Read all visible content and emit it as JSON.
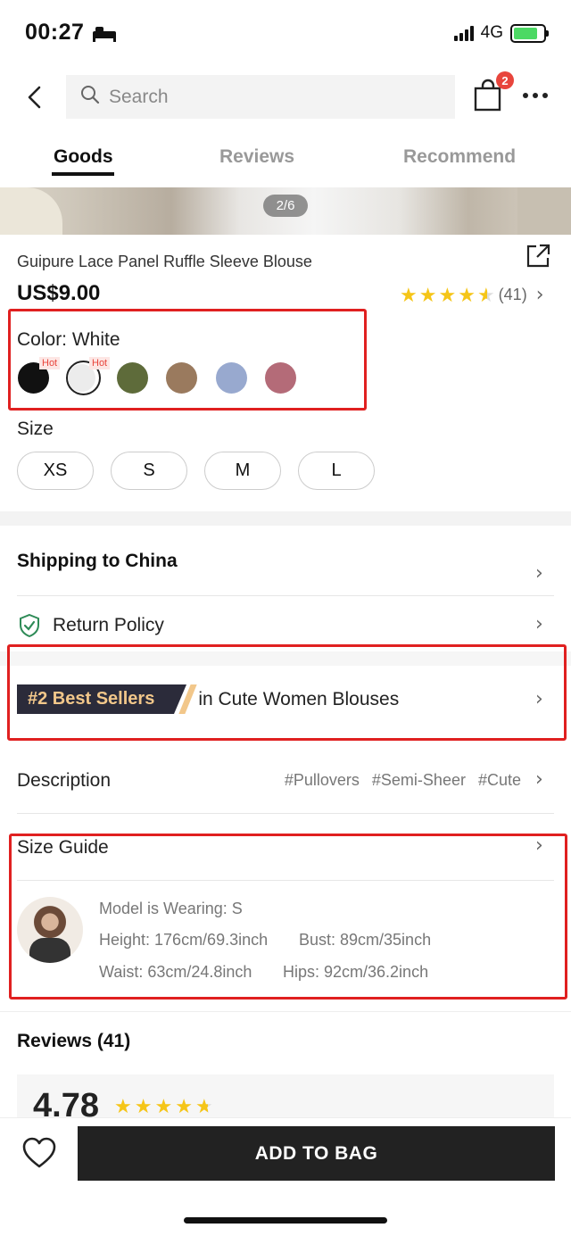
{
  "status_bar": {
    "time": "00:27",
    "network": "4G"
  },
  "header": {
    "search_placeholder": "Search",
    "cart_count": "2"
  },
  "tabs": [
    {
      "label": "Goods",
      "active": true
    },
    {
      "label": "Reviews",
      "active": false
    },
    {
      "label": "Recommend",
      "active": false
    }
  ],
  "gallery": {
    "pager": "2/6"
  },
  "product": {
    "title": "Guipure Lace Panel Ruffle Sleeve Blouse",
    "price": "US$9.00",
    "rating_count": "(41)",
    "rating_stars": 4.5
  },
  "color": {
    "label": "Color: White",
    "hot_label": "Hot",
    "swatches": [
      {
        "name": "black-swatch",
        "color": "#111111",
        "hot": true
      },
      {
        "name": "white-swatch",
        "color": "#ececec",
        "hot": true,
        "selected": true
      },
      {
        "name": "olive-swatch",
        "color": "#5e6b3a",
        "hot": false
      },
      {
        "name": "brown-swatch",
        "color": "#9a7a5e",
        "hot": false
      },
      {
        "name": "blue-swatch",
        "color": "#98a9cf",
        "hot": false
      },
      {
        "name": "rose-swatch",
        "color": "#b46b78",
        "hot": false
      }
    ]
  },
  "size": {
    "label": "Size",
    "options": [
      "XS",
      "S",
      "M",
      "L"
    ]
  },
  "shipping": {
    "label": "Shipping to China"
  },
  "return_policy": {
    "label": "Return Policy"
  },
  "best_sellers": {
    "tag": "#2 Best Sellers",
    "text": "in Cute Women Blouses"
  },
  "description": {
    "label": "Description",
    "tags": [
      "#Pullovers",
      "#Semi-Sheer",
      "#Cute"
    ]
  },
  "size_guide": {
    "label": "Size Guide",
    "model_wearing": "Model is Wearing: S",
    "height": "Height: 176cm/69.3inch",
    "bust": "Bust: 89cm/35inch",
    "waist": "Waist: 63cm/24.8inch",
    "hips": "Hips: 92cm/36.2inch"
  },
  "reviews": {
    "title": "Reviews (41)",
    "score": "4.78"
  },
  "bottom_bar": {
    "add_to_bag": "ADD TO BAG"
  },
  "colors": {
    "accent_red": "#e02020",
    "star": "#f5c518",
    "button_dark": "#222222"
  }
}
